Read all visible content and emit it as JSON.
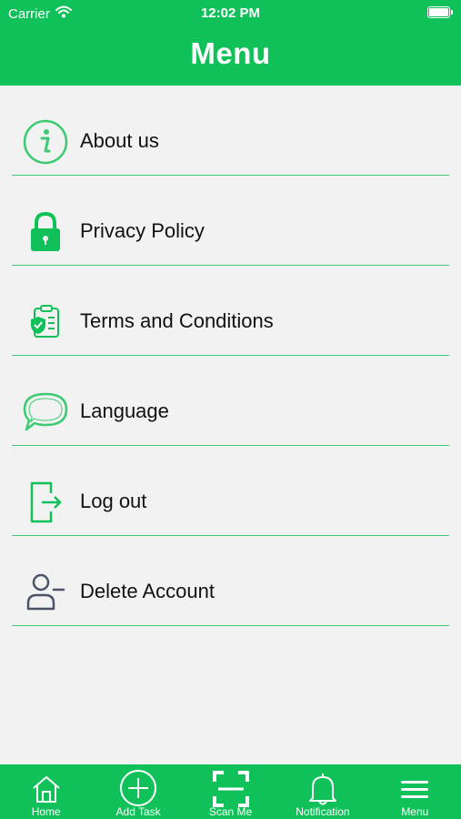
{
  "status_bar": {
    "carrier": "Carrier",
    "time": "12:02 PM"
  },
  "header": {
    "title": "Menu"
  },
  "menu": {
    "items": [
      {
        "label": "About us",
        "icon": "info-icon"
      },
      {
        "label": "Privacy Policy",
        "icon": "lock-icon"
      },
      {
        "label": "Terms and Conditions",
        "icon": "clipboard-shield-icon"
      },
      {
        "label": "Language",
        "icon": "speech-bubble-icon"
      },
      {
        "label": "Log out",
        "icon": "logout-icon"
      },
      {
        "label": "Delete Account",
        "icon": "user-minus-icon"
      }
    ]
  },
  "tabbar": {
    "tabs": [
      {
        "label": "Home",
        "icon": "home-icon"
      },
      {
        "label": "Add Task",
        "icon": "plus-circle-icon"
      },
      {
        "label": "Scan Me",
        "icon": "scan-icon"
      },
      {
        "label": "Notification",
        "icon": "bell-icon"
      },
      {
        "label": "Menu",
        "icon": "hamburger-icon"
      }
    ]
  },
  "colors": {
    "brand": "#10c15a",
    "divider": "#3ccb73",
    "background": "#f2f2f2",
    "user_icon": "#4b5368"
  }
}
